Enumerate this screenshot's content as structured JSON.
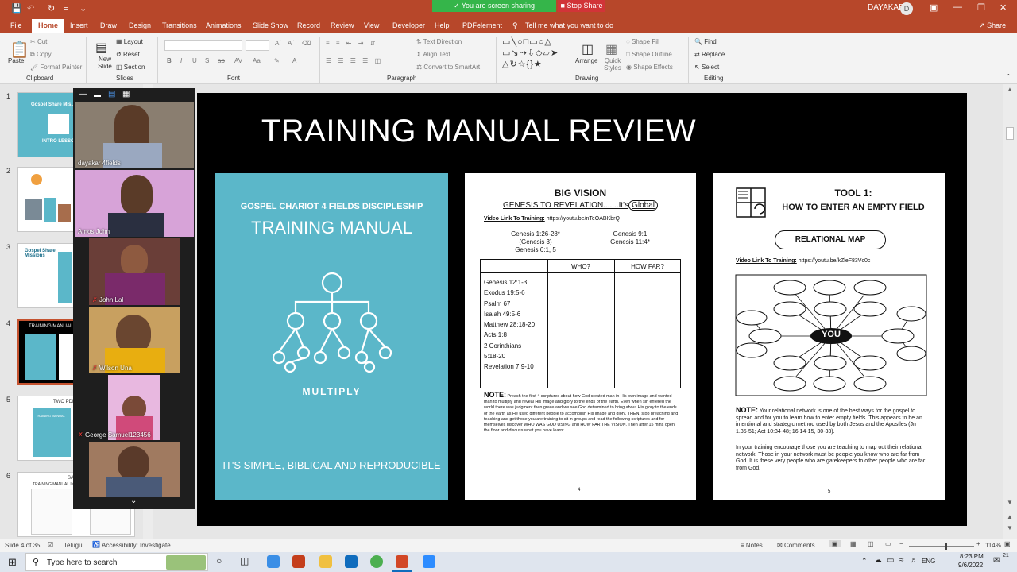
{
  "window": {
    "user_name": "DAYAKAR",
    "user_initial": "D",
    "share_status": "You are screen sharing",
    "stop_share": "Stop Share",
    "share_button": "Share"
  },
  "tabs": [
    "File",
    "Home",
    "Insert",
    "Draw",
    "Design",
    "Transitions",
    "Animations",
    "Slide Show",
    "Record",
    "Review",
    "View",
    "Developer",
    "Help",
    "PDFelement"
  ],
  "tell_me": "Tell me what you want to do",
  "ribbon": {
    "clipboard": {
      "label": "Clipboard",
      "paste": "Paste",
      "cut": "Cut",
      "copy": "Copy",
      "format_painter": "Format Painter"
    },
    "slides": {
      "label": "Slides",
      "new_slide": "New Slide",
      "layout": "Layout",
      "reset": "Reset",
      "section": "Section"
    },
    "font": {
      "label": "Font"
    },
    "paragraph": {
      "label": "Paragraph",
      "text_direction": "Text Direction",
      "align_text": "Align Text",
      "smartart": "Convert to SmartArt"
    },
    "drawing": {
      "label": "Drawing",
      "arrange": "Arrange",
      "quick_styles": "Quick Styles",
      "shape_fill": "Shape Fill",
      "shape_outline": "Shape Outline",
      "shape_effects": "Shape Effects"
    },
    "editing": {
      "label": "Editing",
      "find": "Find",
      "replace": "Replace",
      "select": "Select"
    }
  },
  "thumbnails": [
    {
      "num": "1",
      "caption": "Gospel Share Mis...",
      "sub": "INTRO LESSON"
    },
    {
      "num": "2",
      "caption": "",
      "sub": ""
    },
    {
      "num": "3",
      "caption": "Gospel Share Missions",
      "sub": ""
    },
    {
      "num": "4",
      "caption": "TRAINING MANUAL",
      "sub": ""
    },
    {
      "num": "5",
      "caption": "TWO PDF D...",
      "sub": "TRAINING MANUAL"
    },
    {
      "num": "6",
      "caption": "SAM...",
      "sub": "TRAINING MANUAL INCL PR..."
    }
  ],
  "participants": [
    {
      "name": "dayakar 4fields",
      "muted": false
    },
    {
      "name": "Amos John",
      "muted": false
    },
    {
      "name": "John Lal",
      "muted": true
    },
    {
      "name": "Wilson Una",
      "muted": true
    },
    {
      "name": "George Samuel123456",
      "muted": true
    },
    {
      "name": "",
      "muted": false
    }
  ],
  "slide": {
    "title": "TRAINING MANUAL REVIEW",
    "page1": {
      "header": "GOSPEL CHARIOT 4 FIELDS DISCIPLESHIP",
      "title": "TRAINING MANUAL",
      "icon_label": "MULTIPLY",
      "footer": "IT'S SIMPLE, BIBLICAL AND REPRODUCIBLE"
    },
    "page2": {
      "title": "BIG VISION",
      "subtitle_pre": "GENESIS TO REVELATION.......It's",
      "subtitle_circle": "Global",
      "video_label": "Video Link To Training:",
      "video_url": "https://youtu.be/nTeOABKbrQ",
      "refs_left": "Genesis 1:26-28*\n(Genesis 3)\nGenesis 6:1, 5",
      "refs_right": "Genesis 9:1\nGenesis 11:4*",
      "col_who": "WHO?",
      "col_how": "HOW FAR?",
      "verses": [
        "Genesis 12:1-3",
        "Exodus 19:5-6",
        "Psalm 67",
        "Isaiah 49:5-6",
        "Matthew 28:18-20",
        "Acts 1:8",
        "2 Corinthians",
        "5:18-20",
        "Revelation 7:9-10"
      ],
      "note_label": "NOTE:",
      "note": "Preach the first 4 scriptures about how God created man in His own image and wanted man to multiply and reveal His image and glory to the ends of the earth. Even when sin entered the world there was judgment then grace and we see God determined to bring about His glory to the ends of the earth as He used different people to accomplish His image and glory. THEN, stop preaching and teaching and get those you are training to sit in groups and read the following scriptures and for themselves discover WHO WAS GOD USING and HOW FAR THE VISION. Then after 15 mins open the floor and discuss what you have learnt.",
      "page_num": "4"
    },
    "page3": {
      "title1": "TOOL 1:",
      "title2": "HOW TO ENTER AN EMPTY FIELD",
      "map_title": "RELATIONAL MAP",
      "video_label": "Video Link To Training:",
      "video_url": "https://youtu.be/kZleF83Vc0c",
      "center": "YOU",
      "note_label": "NOTE:",
      "note1": "Your relational network is one of the best ways for the gospel to spread and for you to learn how to enter empty fields. This appears to be an intentional and strategic method used by both Jesus and the Apostles (Jn 1.35-51; Act 10:34-48; 16:14-15, 30-33).",
      "note2": "In your training encourage those you are teaching to map out their relational network. Those in your network must be people you know who are far from God. It is these very people who are gatekeepers to other people who are far from God.",
      "page_num": "5"
    }
  },
  "status": {
    "slide_info": "Slide 4 of 35",
    "language": "Telugu",
    "accessibility": "Accessibility: Investigate",
    "notes": "Notes",
    "comments": "Comments",
    "zoom": "114%"
  },
  "taskbar": {
    "search": "Type here to search",
    "lang": "ENG",
    "time": "8:23 PM",
    "date": "9/6/2022",
    "notif": "21"
  }
}
